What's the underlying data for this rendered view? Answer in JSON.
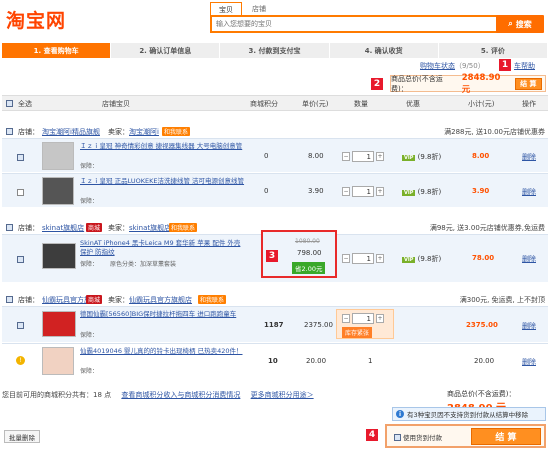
{
  "logo": "淘宝网",
  "search": {
    "tabs": [
      "宝贝",
      "店铺"
    ],
    "placeholder": "输入您想要的宝贝",
    "button": "搜索"
  },
  "steps": [
    "1. 查看购物车",
    "2. 确认订单信息",
    "3. 付款到支付宝",
    "4. 确认收货",
    "5. 评价"
  ],
  "status": {
    "link": "购物车状态",
    "count": "（9/50）",
    "help": "车帮助"
  },
  "markers": [
    "1",
    "2",
    "3",
    "4"
  ],
  "top_summary": {
    "label": "商品总价(不含运费)：",
    "value": "2848.90 元",
    "button": "结 算"
  },
  "header": {
    "select_all": "全选",
    "shop_item": "店铺宝贝",
    "points": "商城积分",
    "unit_price": "单价(元)",
    "qty": "数量",
    "discount": "优惠",
    "subtotal": "小计(元)",
    "action": "操作"
  },
  "shops": [
    {
      "label": "店铺：",
      "name": "淘宝潮阿i精品旗舰",
      "seller_label": "卖家：",
      "seller": "淘宝潮阿i",
      "contact": "和我联系",
      "discount": "满288元, 送10.00元店铺优惠券"
    },
    {
      "label": "店铺：",
      "name": "skinat旗舰店",
      "badge": "商城",
      "seller_label": "卖家：",
      "seller": "skinat旗舰店",
      "contact": "和我联系",
      "discount": "满98元, 送3.00元店铺优惠券,免运费"
    },
    {
      "label": "店铺：",
      "name": "仙霸玩具官方旗舰",
      "badge": "商城",
      "seller_label": "卖家：",
      "seller": "仙霸玩具官方旗舰店",
      "contact": "和我联系",
      "discount": "满300元, 免运费, 上不封顶"
    }
  ],
  "items": [
    {
      "title": "Ｉｚｉ皇冠 神奇情彩创意 捷视器集线器 大号电脑创意管",
      "guarantee": "保障：",
      "points": "0",
      "price": "8.00",
      "qty": "1",
      "vip": "VIP",
      "vip_note": "(9.8折)",
      "subtotal": "8.00",
      "delete": "删除"
    },
    {
      "title": "Ｉｚｉ皇冠 正品LUOKEKE洁洗捷线管 洁可电源创意线管",
      "guarantee": "保障：",
      "points": "0",
      "price": "3.90",
      "qty": "1",
      "vip": "VIP",
      "vip_note": "(9.8折)",
      "subtotal": "3.90",
      "delete": "删除"
    },
    {
      "title": "SkinAT iPhone4 黑卡Leica M9 套华新 苹果 配件 外壳保护 防指纹",
      "guarantee": "保障：",
      "extra": "原色分类：加深草薰套装",
      "points": "0",
      "old_price": "1080.00",
      "price": "798.00",
      "save": "省2.00元",
      "qty": "1",
      "vip": "VIP",
      "vip_note": "(9.8折)",
      "subtotal": "78.00",
      "delete": "删除"
    },
    {
      "title": "德国仙霸[56560]BIG保时捷拉杆拖四车 进口跑跑童车",
      "guarantee": "保障：",
      "points": "1187",
      "price": "2375.00",
      "qty": "1",
      "stock": "库存紧张",
      "subtotal": "2375.00",
      "delete": "删除"
    },
    {
      "title": "仙霸4019046 婴儿真的的铃卡出现椅柄 已热卖420件！",
      "guarantee": "保障：",
      "points": "10",
      "price": "20.00",
      "qty": "1",
      "subtotal": "20.00",
      "delete": "删除"
    }
  ],
  "footer": {
    "points_note": "您目前可用的商城积分共有：18 点",
    "points_links": [
      "查看商城积分收入与商城积分消费情况",
      "更多商城积分用途＞"
    ],
    "total_label": "商品总价(不含运费)：",
    "total": "2848.90 元",
    "info": "有3种宝贝因不支持货到付款从结算中移除",
    "cod": "使用货到付款",
    "checkout": "结 算",
    "batch_delete": "批量删除"
  },
  "colors": {
    "accent": "#ff7400",
    "price": "#ff5100",
    "marker": "#e8192c",
    "link": "#2e55a4"
  }
}
